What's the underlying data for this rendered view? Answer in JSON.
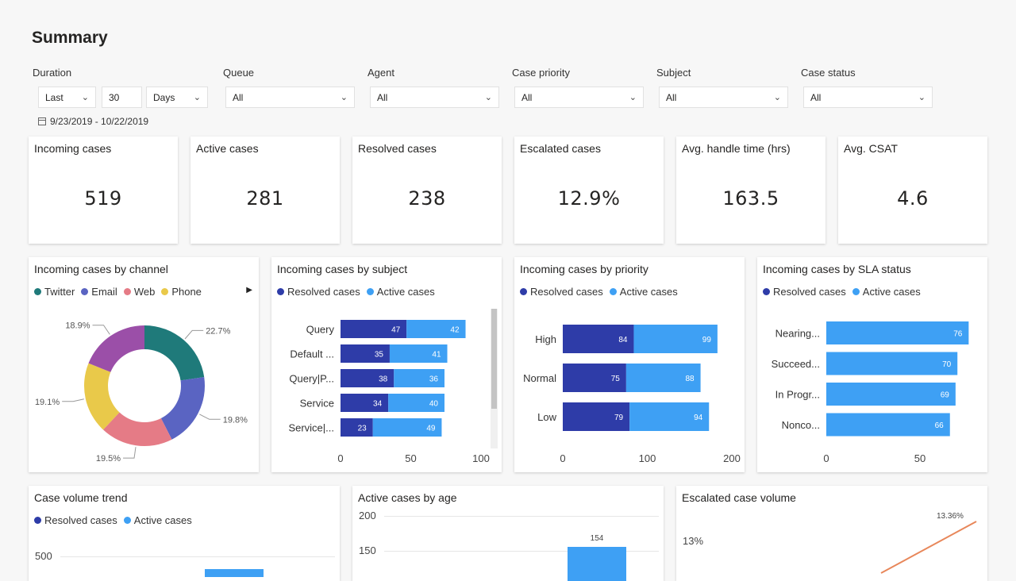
{
  "page": {
    "title": "Summary"
  },
  "filters": {
    "duration": {
      "label": "Duration",
      "mode": "Last",
      "amount": "30",
      "unit": "Days"
    },
    "queue": {
      "label": "Queue",
      "value": "All"
    },
    "agent": {
      "label": "Agent",
      "value": "All"
    },
    "priority": {
      "label": "Case priority",
      "value": "All"
    },
    "subject": {
      "label": "Subject",
      "value": "All"
    },
    "status": {
      "label": "Case status",
      "value": "All"
    },
    "date_range": "9/23/2019 - 10/22/2019"
  },
  "kpis": [
    {
      "title": "Incoming cases",
      "value": "519"
    },
    {
      "title": "Active cases",
      "value": "281"
    },
    {
      "title": "Resolved cases",
      "value": "238"
    },
    {
      "title": "Escalated cases",
      "value": "12.9%"
    },
    {
      "title": "Avg. handle time (hrs)",
      "value": "163.5"
    },
    {
      "title": "Avg. CSAT",
      "value": "4.6"
    }
  ],
  "colors": {
    "resolved": "#2e3ca8",
    "active": "#3ea0f4",
    "twitter": "#1f7a7a",
    "email": "#5a64c2",
    "web": "#e57b86",
    "phone": "#e9c94a",
    "trend_line": "#e8875a"
  },
  "chart_data": [
    {
      "type": "pie",
      "title": "Incoming cases by channel",
      "legend": [
        "Twitter",
        "Email",
        "Web",
        "Phone"
      ],
      "labels": [
        "22.7%",
        "19.8%",
        "19.5%",
        "19.1%",
        "18.9%"
      ],
      "values": [
        22.7,
        19.8,
        19.5,
        19.1,
        18.9
      ]
    },
    {
      "type": "bar",
      "title": "Incoming cases by subject",
      "legend": [
        "Resolved cases",
        "Active cases"
      ],
      "categories": [
        "Query",
        "Default ...",
        "Query|P...",
        "Service",
        "Service|..."
      ],
      "series": [
        {
          "name": "Resolved cases",
          "values": [
            47,
            35,
            38,
            34,
            23
          ]
        },
        {
          "name": "Active cases",
          "values": [
            42,
            41,
            36,
            40,
            49
          ]
        }
      ],
      "xticks": [
        "0",
        "50",
        "100"
      ],
      "xlim": [
        0,
        100
      ]
    },
    {
      "type": "bar",
      "title": "Incoming cases by priority",
      "legend": [
        "Resolved cases",
        "Active cases"
      ],
      "categories": [
        "High",
        "Normal",
        "Low"
      ],
      "series": [
        {
          "name": "Resolved cases",
          "values": [
            84,
            75,
            79
          ]
        },
        {
          "name": "Active cases",
          "values": [
            99,
            88,
            94
          ]
        }
      ],
      "xticks": [
        "0",
        "100",
        "200"
      ],
      "xlim": [
        0,
        200
      ]
    },
    {
      "type": "bar",
      "title": "Incoming cases by SLA status",
      "legend": [
        "Resolved cases",
        "Active cases"
      ],
      "categories": [
        "Nearing...",
        "Succeed...",
        "In Progr...",
        "Nonco..."
      ],
      "series": [
        {
          "name": "Resolved cases",
          "values": [
            0,
            0,
            0,
            0
          ]
        },
        {
          "name": "Active cases",
          "values": [
            76,
            70,
            69,
            66
          ]
        }
      ],
      "xticks": [
        "0",
        "50"
      ],
      "xlim": [
        0,
        50
      ]
    },
    {
      "type": "bar",
      "title": "Case volume trend",
      "legend": [
        "Resolved cases",
        "Active cases"
      ],
      "yticks": [
        "500"
      ]
    },
    {
      "type": "bar",
      "title": "Active cases by age",
      "yticks": [
        "200",
        "150"
      ],
      "values": [
        154
      ]
    },
    {
      "type": "line",
      "title": "Escalated case volume",
      "yticks": [
        "13%"
      ],
      "labels": [
        "13.36%"
      ]
    }
  ]
}
